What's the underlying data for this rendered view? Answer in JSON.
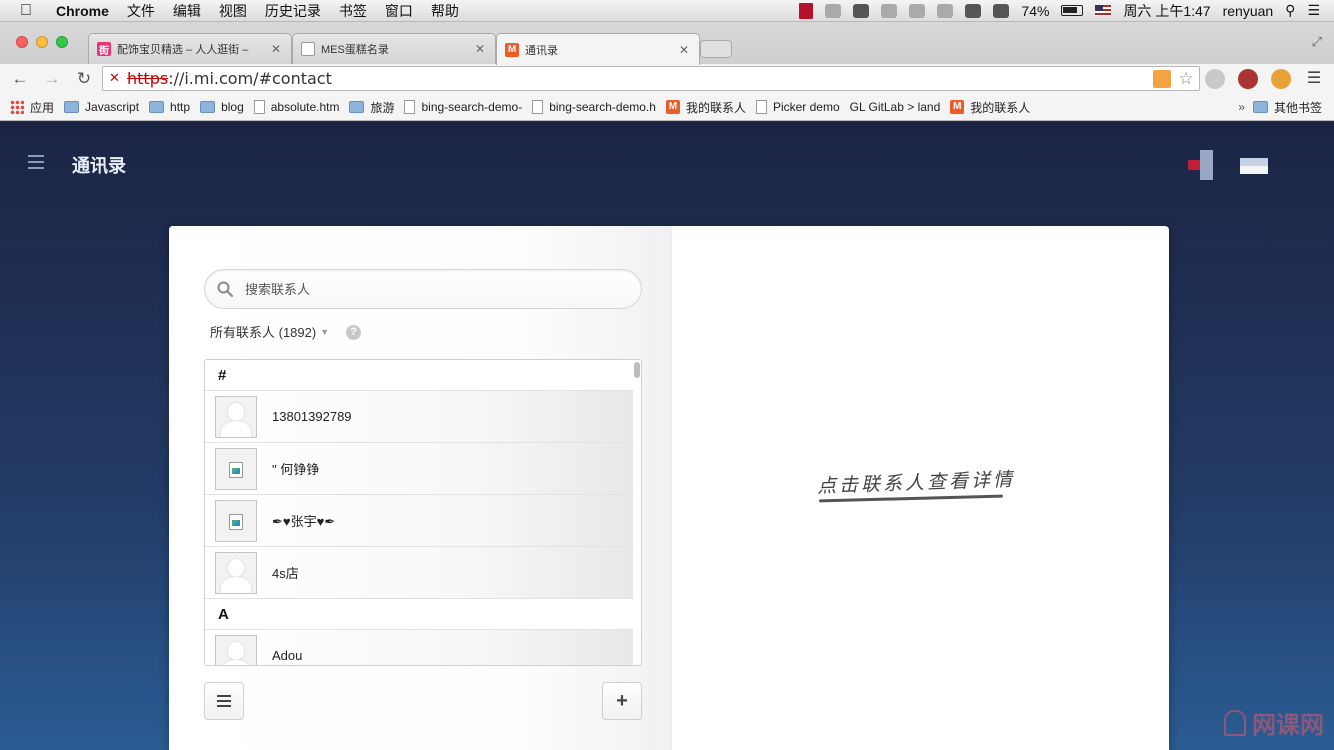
{
  "menubar": {
    "app": "Chrome",
    "items": [
      "文件",
      "编辑",
      "视图",
      "历史记录",
      "书签",
      "窗口",
      "帮助"
    ],
    "battery": "74%",
    "clock": "周六 上午1:47",
    "user": "renyuan"
  },
  "tabs": [
    {
      "label": "配饰宝贝精选 – 人人逛街 –",
      "icon": "pink-store-icon"
    },
    {
      "label": "MES蛋糕名录",
      "icon": "document-icon"
    },
    {
      "label": "通讯录",
      "icon": "mi-icon",
      "active": true
    }
  ],
  "omnibox": {
    "scheme": "https",
    "rest": "://i.mi.com/#contact"
  },
  "bookmarks": [
    {
      "label": "应用",
      "icon": "apps"
    },
    {
      "label": "Javascript",
      "icon": "folder"
    },
    {
      "label": "http",
      "icon": "folder"
    },
    {
      "label": "blog",
      "icon": "folder"
    },
    {
      "label": "absolute.htm",
      "icon": "page"
    },
    {
      "label": "旅游",
      "icon": "folder"
    },
    {
      "label": "bing-search-demo-",
      "icon": "page"
    },
    {
      "label": "bing-search-demo.h",
      "icon": "page"
    },
    {
      "label": "我的联系人",
      "icon": "mi"
    },
    {
      "label": "Picker demo",
      "icon": "page"
    },
    {
      "label": "GL GitLab > land",
      "icon": "none"
    },
    {
      "label": "我的联系人",
      "icon": "mi"
    }
  ],
  "bookmarks_overflow": "»",
  "bookmarks_other": "其他书签",
  "app": {
    "title": "通讯录"
  },
  "contacts": {
    "search_placeholder": "搜索联系人",
    "group_label": "所有联系人 (1892)",
    "help": "?",
    "sections": [
      {
        "header": "#",
        "items": [
          {
            "name": "13801392789",
            "avatar": "default"
          },
          {
            "name": "\" 何铮铮",
            "avatar": "broken"
          },
          {
            "name": "✒♥张宇♥✒",
            "avatar": "broken"
          },
          {
            "name": "4s店",
            "avatar": "default"
          }
        ]
      },
      {
        "header": "A",
        "items": [
          {
            "name": "Adou",
            "avatar": "default"
          }
        ]
      }
    ],
    "add_button": "+",
    "empty_detail": "点击联系人查看详情"
  },
  "watermark": "网课网"
}
